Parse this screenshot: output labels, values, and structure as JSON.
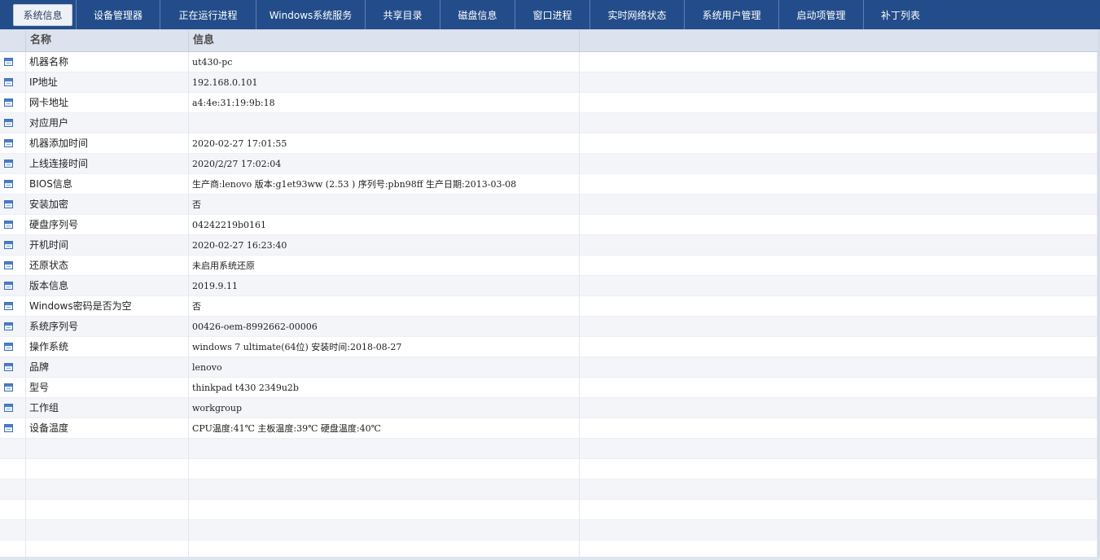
{
  "tabs": [
    {
      "label": "系统信息",
      "active": true
    },
    {
      "label": "设备管理器"
    },
    {
      "label": "正在运行进程"
    },
    {
      "label": "Windows系统服务"
    },
    {
      "label": "共享目录"
    },
    {
      "label": "磁盘信息"
    },
    {
      "label": "窗口进程"
    },
    {
      "label": "实时网络状态"
    },
    {
      "label": "系统用户管理"
    },
    {
      "label": "启动项管理"
    },
    {
      "label": "补丁列表"
    }
  ],
  "grid": {
    "headers": {
      "name": "名称",
      "info": "信息"
    },
    "rows": [
      {
        "name": "机器名称",
        "info": "ut430-pc"
      },
      {
        "name": "IP地址",
        "info": "192.168.0.101"
      },
      {
        "name": "网卡地址",
        "info": "a4:4e:31:19:9b:18"
      },
      {
        "name": "对应用户",
        "info": ""
      },
      {
        "name": "机器添加时间",
        "info": "2020-02-27 17:01:55"
      },
      {
        "name": "上线连接时间",
        "info": "2020/2/27 17:02:04"
      },
      {
        "name": "BIOS信息",
        "info": "生产商:lenovo  版本:g1et93ww (2.53 ) 序列号:pbn98ff 生产日期:2013-03-08"
      },
      {
        "name": "安装加密",
        "info": "否"
      },
      {
        "name": "硬盘序列号",
        "info": "04242219b0161"
      },
      {
        "name": "开机时间",
        "info": "2020-02-27 16:23:40"
      },
      {
        "name": "还原状态",
        "info": "未启用系统还原"
      },
      {
        "name": "版本信息",
        "info": "2019.9.11"
      },
      {
        "name": "Windows密码是否为空",
        "info": "否"
      },
      {
        "name": "系统序列号",
        "info": "00426-oem-8992662-00006"
      },
      {
        "name": "操作系统",
        "info": "windows 7 ultimate(64位)   安装时间:2018-08-27"
      },
      {
        "name": "品牌",
        "info": "lenovo"
      },
      {
        "name": "型号",
        "info": "thinkpad t430 2349u2b"
      },
      {
        "name": "工作组",
        "info": "workgroup"
      },
      {
        "name": "设备温度",
        "info": "CPU温度:41℃  主板温度:39℃  硬盘温度:40℃"
      }
    ]
  },
  "icons": {
    "row": "table-row-icon"
  },
  "colors": {
    "tabbar": "#234d8a",
    "header": "#dde3ee",
    "alt_row": "#f3f5f9"
  }
}
